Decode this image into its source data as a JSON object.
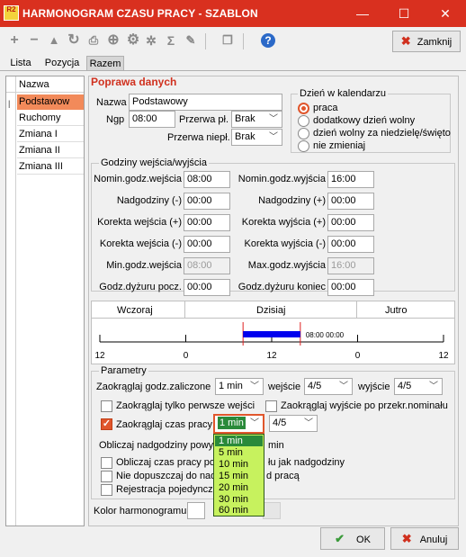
{
  "window": {
    "logo": "R2",
    "title": "HARMONOGRAM CZASU PRACY - SZABLON",
    "minimize": "—",
    "maximize": "☐",
    "close": "✕"
  },
  "toolbar": {
    "close_label": "Zamknij"
  },
  "tabs": [
    "Lista",
    "Pozycja",
    "Razem"
  ],
  "list": {
    "header": "Nazwa",
    "items": [
      "Podstawow",
      "Ruchomy",
      "Zmiana I",
      "Zmiana II",
      "Zmiana III"
    ]
  },
  "section_title": "Poprawa danych",
  "form": {
    "nazwa_label": "Nazwa",
    "nazwa_value": "Podstawowy",
    "ngp_label": "Ngp",
    "ngp_value": "08:00",
    "przerwa_pl_label": "Przerwa pł.",
    "przerwa_pl_value": "Brak",
    "przerwa_niepl_label": "Przerwa niepł.",
    "przerwa_niepl_value": "Brak"
  },
  "calendar": {
    "title": "Dzień w kalendarzu",
    "options": [
      "praca",
      "dodatkowy dzień wolny",
      "dzień wolny za niedzielę/święto",
      "nie zmieniaj"
    ]
  },
  "hours": {
    "title": "Godziny wejścia/wyjścia",
    "left": [
      {
        "label": "Nomin.godz.wejścia",
        "value": "08:00"
      },
      {
        "label": "Nadgodziny (-)",
        "value": "00:00"
      },
      {
        "label": "Korekta wejścia (+)",
        "value": "00:00"
      },
      {
        "label": "Korekta wejścia (-)",
        "value": "00:00"
      },
      {
        "label": "Min.godz.wejścia",
        "value": "08:00"
      },
      {
        "label": "Godz.dyżuru pocz.",
        "value": "00:00"
      }
    ],
    "right": [
      {
        "label": "Nomin.godz.wyjścia",
        "value": "16:00"
      },
      {
        "label": "Nadgodziny (+)",
        "value": "00:00"
      },
      {
        "label": "Korekta wyjścia (+)",
        "value": "00:00"
      },
      {
        "label": "Korekta wyjścia (-)",
        "value": "00:00"
      },
      {
        "label": "Max.godz.wyjścia",
        "value": "16:00"
      },
      {
        "label": "Godz.dyżuru koniec",
        "value": "00:00"
      }
    ]
  },
  "timeline": {
    "days": [
      "Wczoraj",
      "Dzisiaj",
      "Jutro"
    ],
    "ticks": [
      "12",
      "0",
      "12",
      "0",
      "12"
    ],
    "bar_label": "08:00 00:00",
    "bar_start_hour": 8,
    "bar_end_hour": 16
  },
  "params": {
    "title": "Parametry",
    "round_label": "Zaokrąglaj  godz.zaliczone",
    "round_value": "1 min",
    "wejscie_label": "wejście",
    "wejscie_value": "4/5",
    "wyjscie_label": "wyjście",
    "wyjscie_value": "4/5",
    "cb_first_entries": "Zaokrąglaj tylko perwsze wejści",
    "cb_exit_nominal": "Zaokrąglaj wyjście po przekr.nominału",
    "cb_work_time": "Zaokrąglaj czas pracy",
    "work_time_value": "1 min",
    "work_time_frac": "4/5",
    "overtime_label_a": "Obliczaj nadgodziny powyż",
    "overtime_label_b": "min",
    "cb_calc_a": "Obliczaj czas pracy po",
    "cb_calc_b": "łu jak nadgodziny",
    "cb_nodopusc_a": "Nie dopuszczaj do nad",
    "cb_nodopusc_b": "d pracą",
    "cb_rejestr": "Rejestracja pojedyncz"
  },
  "dropdown": {
    "options": [
      "1 min",
      "5 min",
      "10 min",
      "15 min",
      "20 min",
      "30 min",
      "60 min"
    ],
    "selected": "1 min"
  },
  "color_label": "Kolor harmonogramu",
  "buttons": {
    "ok": "OK",
    "cancel": "Anuluj"
  }
}
